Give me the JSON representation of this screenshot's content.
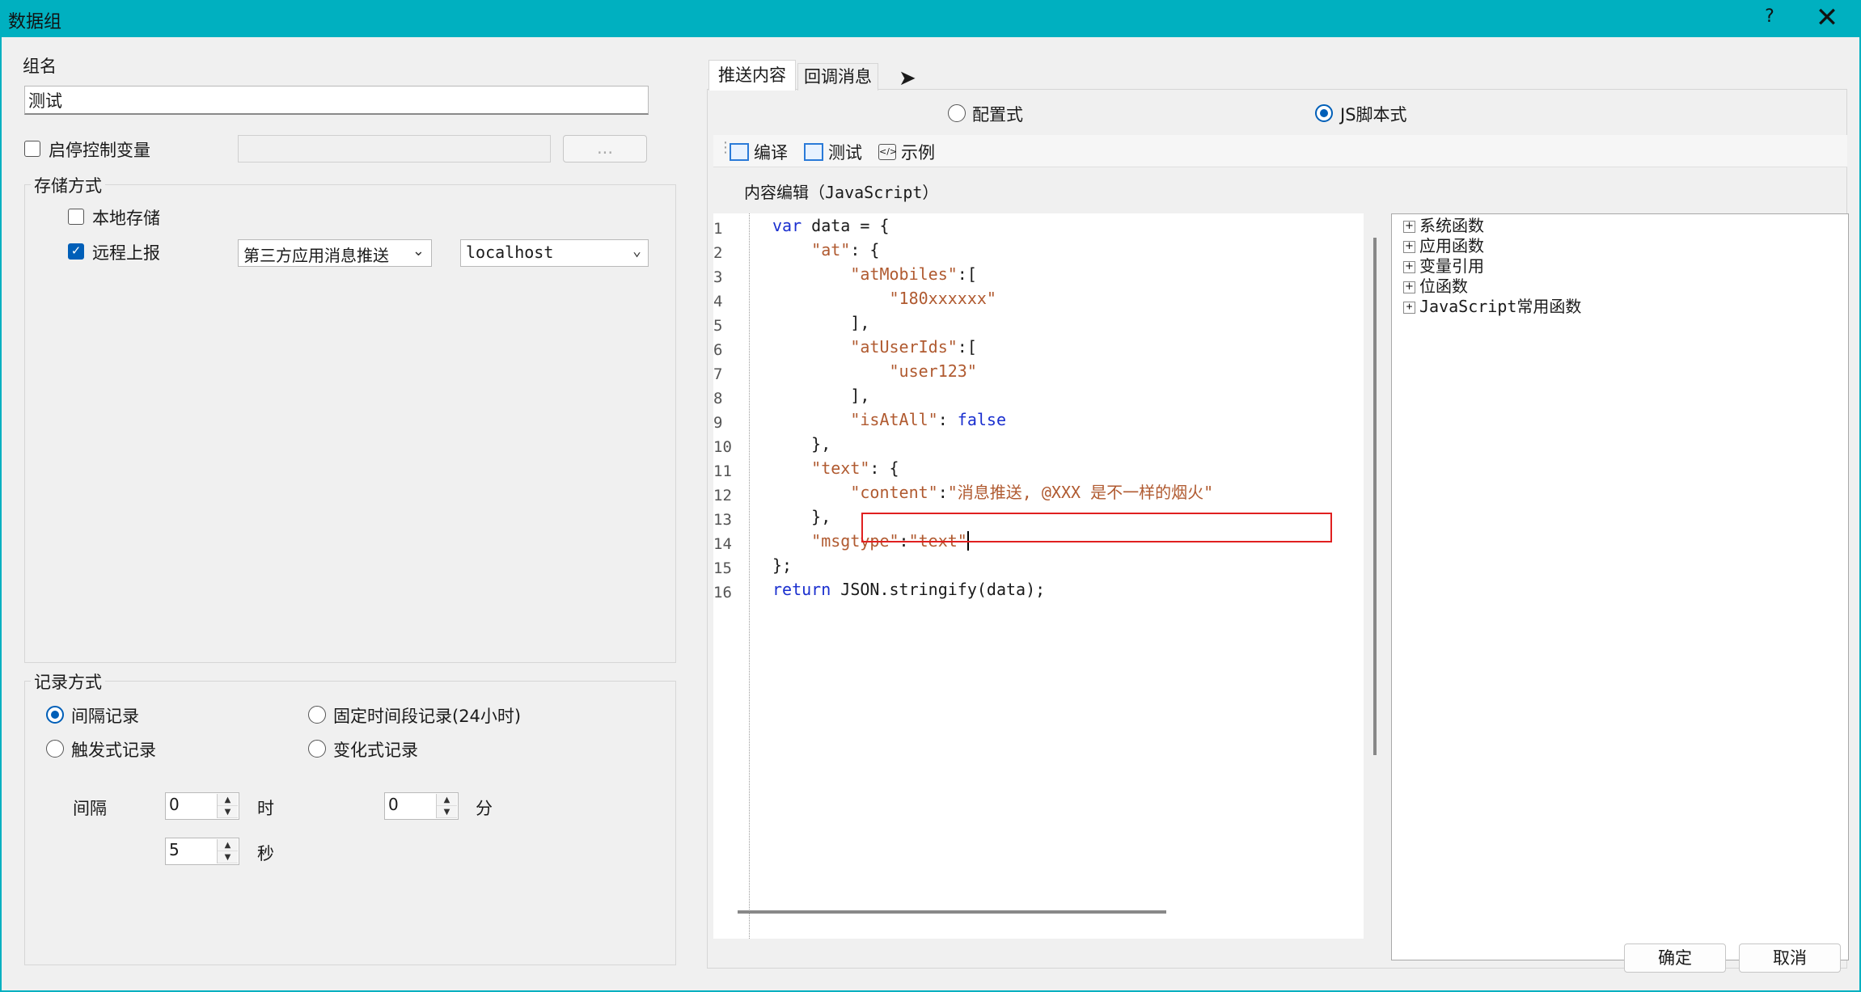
{
  "window": {
    "title": "数据组",
    "help": "?",
    "close": "✕"
  },
  "left": {
    "group_name_label": "组名",
    "group_name_value": "测试",
    "enable_control_label": "启停控制变量",
    "enable_control_checked": false,
    "browse_button": "...",
    "storage": {
      "title": "存储方式",
      "local_label": "本地存储",
      "local_checked": false,
      "remote_label": "远程上报",
      "remote_checked": true,
      "method_select": "第三方应用消息推送",
      "host_select": "localhost"
    },
    "record": {
      "title": "记录方式",
      "options": [
        "间隔记录",
        "固定时间段记录(24小时)",
        "触发式记录",
        "变化式记录"
      ],
      "selected": "间隔记录",
      "interval_label": "间隔",
      "hours_value": "0",
      "hours_unit": "时",
      "minutes_value": "0",
      "minutes_unit": "分",
      "seconds_value": "5",
      "seconds_unit": "秒"
    }
  },
  "right": {
    "tabs": [
      "推送内容",
      "回调消息"
    ],
    "active_tab": "推送内容",
    "mode_config": "配置式",
    "mode_js": "JS脚本式",
    "mode_selected": "JS脚本式",
    "toolbar": {
      "compile": "编译",
      "test": "测试",
      "example": "示例"
    },
    "editor_label": "内容编辑（JavaScript）",
    "tree": [
      "系统函数",
      "应用函数",
      "变量引用",
      "位函数",
      "JavaScript常用函数"
    ]
  },
  "footer": {
    "ok": "确定",
    "cancel": "取消"
  },
  "colors": {
    "titlebar": "#00b0c0",
    "accent": "#005fb8",
    "highlight_box": "#e02020",
    "keyword": "#1a2fcf",
    "string": "#b05a30"
  }
}
